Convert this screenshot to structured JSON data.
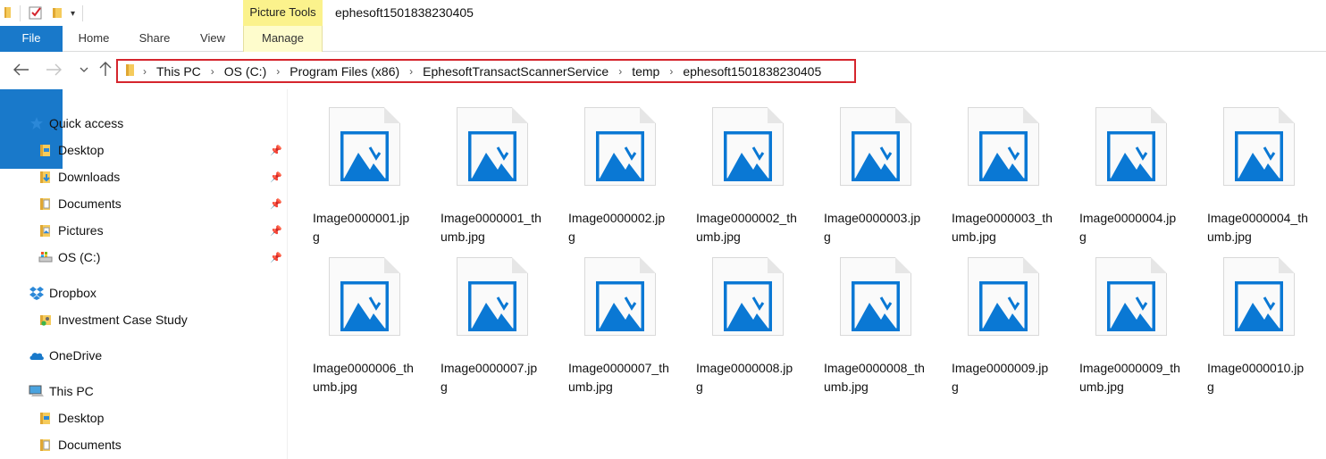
{
  "window": {
    "title": "ephesoft1501838230405",
    "context_tab_header": "Picture Tools"
  },
  "ribbon": {
    "tabs": [
      {
        "label": "File"
      },
      {
        "label": "Home"
      },
      {
        "label": "Share"
      },
      {
        "label": "View"
      },
      {
        "label": "Manage"
      }
    ]
  },
  "address": {
    "crumbs": [
      "This PC",
      "OS (C:)",
      "Program Files (x86)",
      "EphesoftTransactScannerService",
      "temp",
      "ephesoft1501838230405"
    ],
    "highlight_color": "#d5252d"
  },
  "sidebar": {
    "items": [
      {
        "label": "Quick access",
        "icon": "star-icon"
      },
      {
        "label": "Desktop",
        "icon": "folder-icon",
        "pinned": true
      },
      {
        "label": "Downloads",
        "icon": "downloads-icon",
        "pinned": true
      },
      {
        "label": "Documents",
        "icon": "documents-icon",
        "pinned": true
      },
      {
        "label": "Pictures",
        "icon": "pictures-icon",
        "pinned": true
      },
      {
        "label": "OS (C:)",
        "icon": "drive-icon",
        "pinned": true
      },
      {
        "label": "Dropbox",
        "icon": "dropbox-icon"
      },
      {
        "label": "Investment Case Study",
        "icon": "shared-folder-icon"
      },
      {
        "label": "OneDrive",
        "icon": "onedrive-icon"
      },
      {
        "label": "This PC",
        "icon": "computer-icon"
      },
      {
        "label": "Desktop",
        "icon": "folder-icon"
      },
      {
        "label": "Documents",
        "icon": "documents-icon"
      }
    ]
  },
  "files": [
    {
      "line1": "Image0000001.jp",
      "line2": "g"
    },
    {
      "line1": "Image0000001_th",
      "line2": "umb.jpg"
    },
    {
      "line1": "Image0000002.jp",
      "line2": "g"
    },
    {
      "line1": "Image0000002_th",
      "line2": "umb.jpg"
    },
    {
      "line1": "Image0000003.jp",
      "line2": "g"
    },
    {
      "line1": "Image0000003_th",
      "line2": "umb.jpg"
    },
    {
      "line1": "Image0000004.jp",
      "line2": "g"
    },
    {
      "line1": "Image0000004_th",
      "line2": "umb.jpg"
    },
    {
      "line1": "Image0000006_th",
      "line2": "umb.jpg"
    },
    {
      "line1": "Image0000007.jp",
      "line2": "g"
    },
    {
      "line1": "Image0000007_th",
      "line2": "umb.jpg"
    },
    {
      "line1": "Image0000008.jp",
      "line2": "g"
    },
    {
      "line1": "Image0000008_th",
      "line2": "umb.jpg"
    },
    {
      "line1": "Image0000009.jp",
      "line2": "g"
    },
    {
      "line1": "Image0000009_th",
      "line2": "umb.jpg"
    },
    {
      "line1": "Image0000010.jp",
      "line2": "g"
    }
  ],
  "colors": {
    "accent": "#1979ca",
    "picture_icon": "#0a78d4"
  }
}
